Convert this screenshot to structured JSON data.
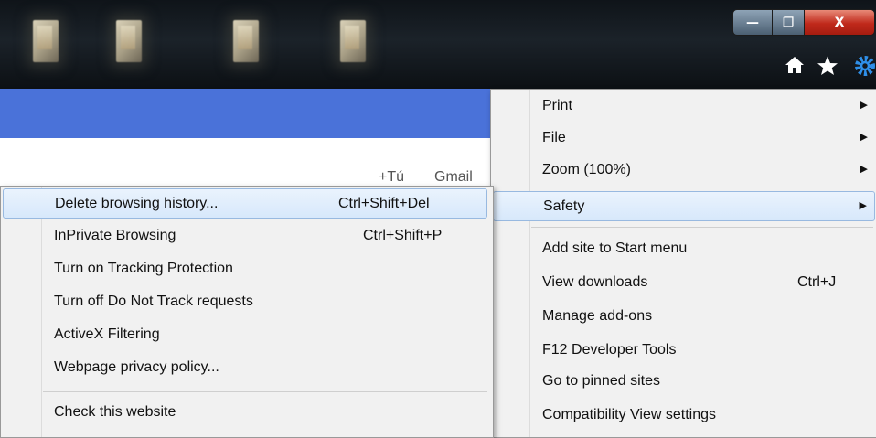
{
  "window": {
    "controls": {
      "minimize": "—",
      "maximize": "❐",
      "close": "X"
    }
  },
  "toolbar": {
    "icons": [
      "home-icon",
      "favorites-icon",
      "tools-gear-icon"
    ]
  },
  "page": {
    "links": [
      "+Tú",
      "Gmail"
    ]
  },
  "tools_menu": {
    "items": [
      {
        "label": "Print",
        "submenu": true
      },
      {
        "label": "File",
        "submenu": true
      },
      {
        "label": "Zoom (100%)",
        "submenu": true
      },
      {
        "label": "Safety",
        "submenu": true,
        "highlighted": true
      },
      {
        "label": "Add site to Start menu"
      },
      {
        "label": "View downloads",
        "shortcut": "Ctrl+J"
      },
      {
        "label": "Manage add-ons"
      },
      {
        "label": "F12 Developer Tools"
      },
      {
        "label": "Go to pinned sites"
      },
      {
        "label": "Compatibility View settings"
      }
    ]
  },
  "safety_submenu": {
    "items": [
      {
        "label": "Delete browsing history...",
        "shortcut": "Ctrl+Shift+Del",
        "highlighted": true
      },
      {
        "label": "InPrivate Browsing",
        "shortcut": "Ctrl+Shift+P"
      },
      {
        "label": "Turn on Tracking Protection"
      },
      {
        "label": "Turn off Do Not Track requests"
      },
      {
        "label": "ActiveX Filtering"
      },
      {
        "label": "Webpage privacy policy..."
      },
      {
        "label": "Check this website"
      }
    ]
  },
  "colors": {
    "accent_bar": "#4a72d9",
    "menu_bg": "#f1f1f1",
    "highlight_border": "#98b9e0",
    "close_button": "#c0291b"
  }
}
